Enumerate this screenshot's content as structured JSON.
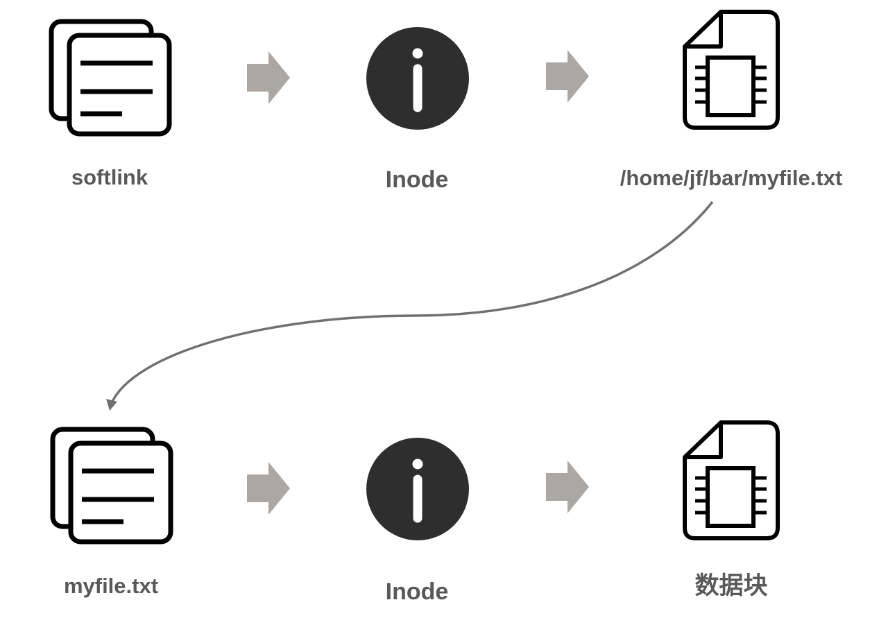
{
  "colors": {
    "icon": "#000000",
    "inode_fill": "#2e2e2e",
    "arrow": "#aaa7a5",
    "curve": "#707070",
    "label": "#595959"
  },
  "top_row": {
    "file_label": "softlink",
    "inode_label": "Inode",
    "data_label": "/home/jf/bar/myfile.txt"
  },
  "bottom_row": {
    "file_label": "myfile.txt",
    "inode_label": "Inode",
    "data_label": "数据块"
  },
  "icons": {
    "file_entry": "document-stack-icon",
    "inode": "info-circle-icon",
    "data_block": "chip-document-icon",
    "flow_arrow": "block-arrow-right-icon",
    "link_curve": "curved-arrow-icon"
  }
}
